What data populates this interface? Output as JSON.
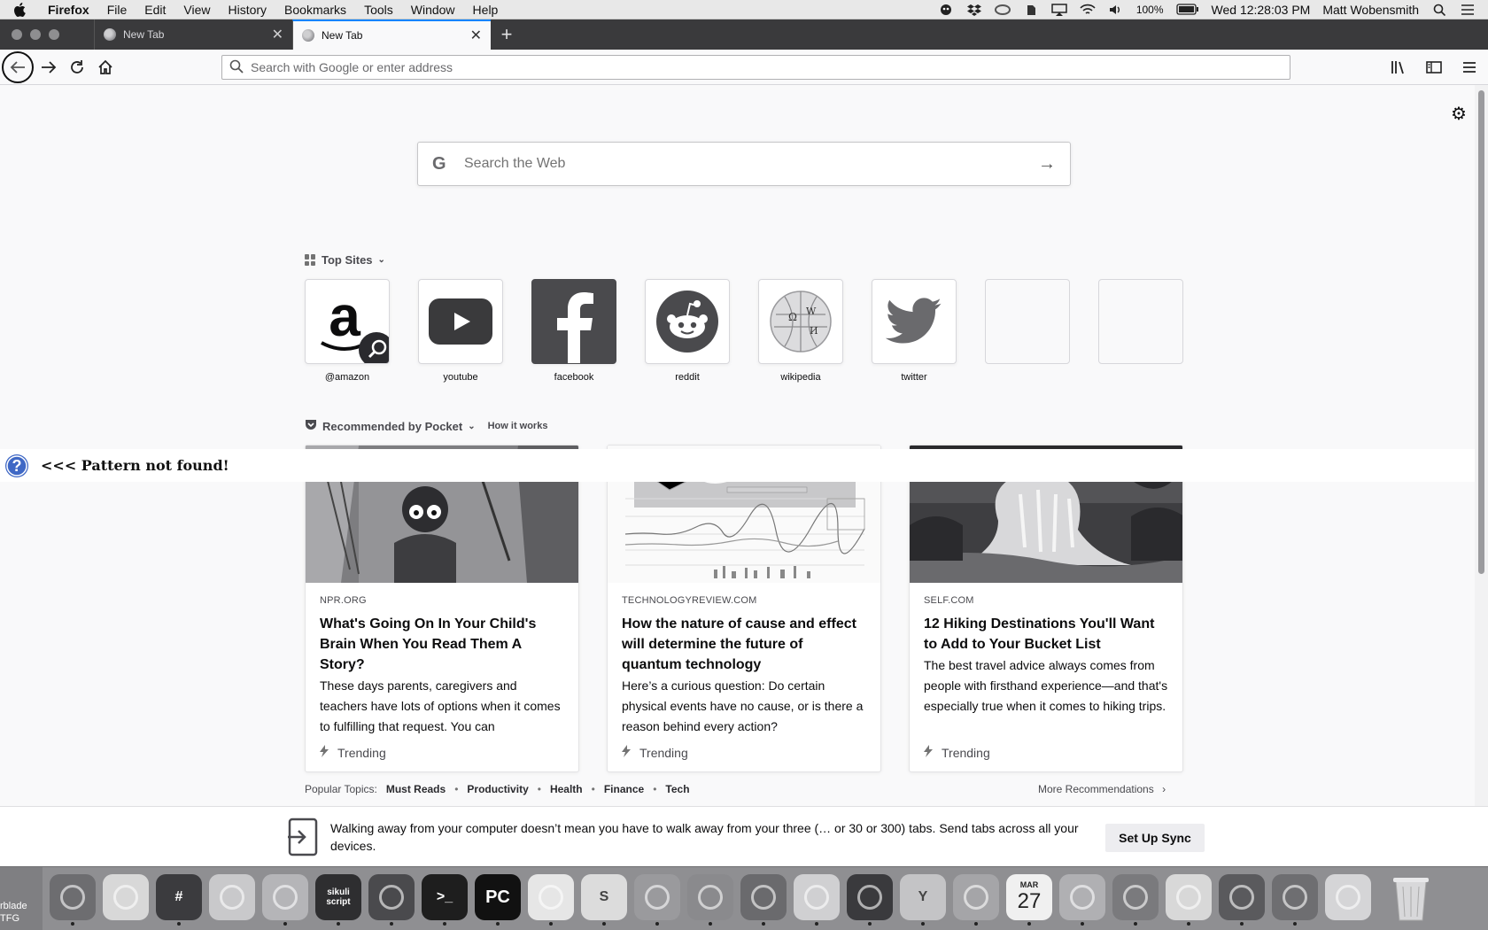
{
  "menubar": {
    "app_name": "Firefox",
    "menus": [
      "File",
      "Edit",
      "View",
      "History",
      "Bookmarks",
      "Tools",
      "Window",
      "Help"
    ],
    "battery": "100%",
    "clock": "Wed 12:28:03 PM",
    "user": "Matt Wobensmith"
  },
  "tabs": [
    {
      "title": "New Tab",
      "active": false
    },
    {
      "title": "New Tab",
      "active": true
    }
  ],
  "urlbar": {
    "placeholder": "Search with Google or enter address"
  },
  "web_search": {
    "placeholder": "Search the Web"
  },
  "top_sites": {
    "title": "Top Sites",
    "sites": [
      {
        "label": "@amazon",
        "icon": "amazon-icon"
      },
      {
        "label": "youtube",
        "icon": "youtube-icon"
      },
      {
        "label": "facebook",
        "icon": "facebook-icon"
      },
      {
        "label": "reddit",
        "icon": "reddit-icon"
      },
      {
        "label": "wikipedia",
        "icon": "wikipedia-icon"
      },
      {
        "label": "twitter",
        "icon": "twitter-icon"
      },
      {
        "label": "",
        "icon": ""
      },
      {
        "label": "",
        "icon": ""
      }
    ]
  },
  "pattern_message": "<<< Pattern not found!",
  "pocket": {
    "title": "Recommended by Pocket",
    "how_it_works": "How it works",
    "cards": [
      {
        "source": "NPR.ORG",
        "headline": "What's Going On In Your Child's Brain When You Read Them A Story?",
        "description": "These days parents, caregivers and teachers have lots of options when it comes to fulfilling that request. You can",
        "badge": "Trending"
      },
      {
        "source": "TECHNOLOGYREVIEW.COM",
        "headline": "How the nature of cause and effect will determine the future of quantum technology",
        "description": "Here’s a curious question: Do certain physical events have no cause, or is there a reason behind every action?",
        "badge": "Trending"
      },
      {
        "source": "SELF.COM",
        "headline": "12 Hiking Destinations You'll Want to Add to Your Bucket List",
        "description": "The best travel advice always comes from people with firsthand experience—and that's especially true when it comes to hiking trips.",
        "badge": "Trending"
      }
    ],
    "popular_label": "Popular Topics:",
    "topics": [
      "Must Reads",
      "Productivity",
      "Health",
      "Finance",
      "Tech"
    ],
    "more": "More Recommendations"
  },
  "sync": {
    "message": "Walking away from your computer doesn’t mean you have to walk away from your three (… or 30 or 300) tabs. Send tabs across all your devices.",
    "button": "Set Up Sync"
  },
  "dock": {
    "edge_label": "rblade\nTFG",
    "calendar_month": "MAR",
    "calendar_day": "27",
    "sikuli_label": "sikuli script",
    "pycharm_label": "PC",
    "apps": [
      {
        "name": "finder-icon",
        "color": "#6d6d70"
      },
      {
        "name": "textedit-icon",
        "color": "#d8d8d8"
      },
      {
        "name": "slack-icon",
        "color": "#3b3b3e"
      },
      {
        "name": "script-editor-icon",
        "color": "#c9c9cb"
      },
      {
        "name": "safari-icon",
        "color": "#b5b5b8"
      },
      {
        "name": "sikuli-icon",
        "color": "#2e2e30"
      },
      {
        "name": "sublime-icon",
        "color": "#4a4a4d"
      },
      {
        "name": "terminal-icon",
        "color": "#1e1e1e"
      },
      {
        "name": "pycharm-icon",
        "color": "#111111"
      },
      {
        "name": "evernote-icon",
        "color": "#e6e6e6"
      },
      {
        "name": "skype-icon",
        "color": "#dcdcdc"
      },
      {
        "name": "cyberduck-icon",
        "color": "#9a9a9d"
      },
      {
        "name": "migration-icon",
        "color": "#8a8a8d"
      },
      {
        "name": "firefox-icon",
        "color": "#6a6a6d"
      },
      {
        "name": "cisco-icon",
        "color": "#d0d0d2"
      },
      {
        "name": "firefox-dev-icon",
        "color": "#3a3a3d"
      },
      {
        "name": "yoink-icon",
        "color": "#c4c4c6"
      },
      {
        "name": "spreadsheet-icon",
        "color": "#a5a5a8"
      },
      {
        "name": "calendar-icon",
        "color": "#f0f0f0"
      },
      {
        "name": "chrome-icon",
        "color": "#b0b0b3"
      },
      {
        "name": "network-icon",
        "color": "#7a7a7d"
      },
      {
        "name": "whatsapp-icon",
        "color": "#d8d8d8"
      },
      {
        "name": "system-prefs-icon",
        "color": "#5a5a5d"
      },
      {
        "name": "firefox-nightly-icon",
        "color": "#6e6e71"
      },
      {
        "name": "document-icon",
        "color": "#d5d5d7"
      }
    ]
  }
}
